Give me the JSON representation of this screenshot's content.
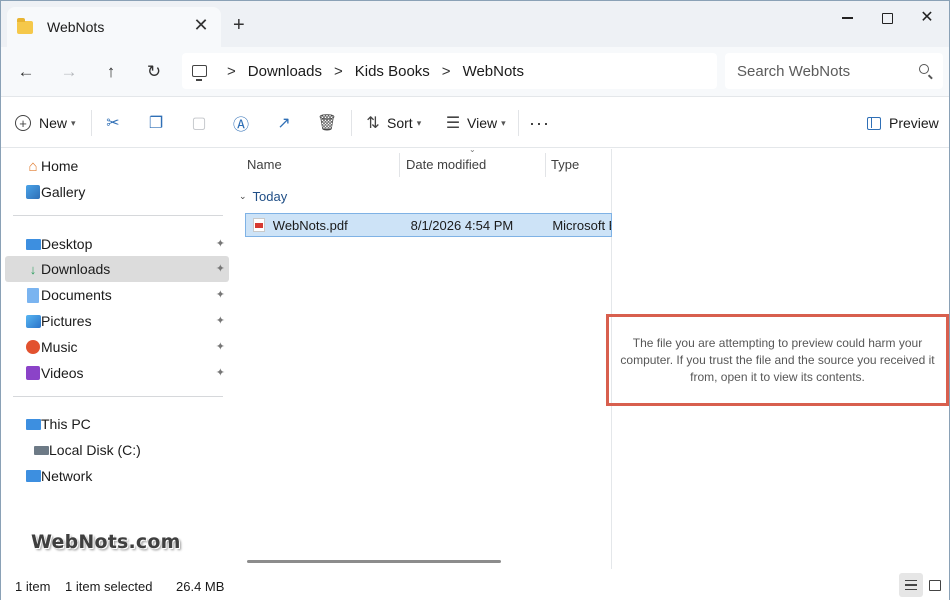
{
  "titlebar": {
    "tab_title": "WebNots",
    "tab_close": "✕",
    "new_tab": "+",
    "minimize": "",
    "maximize": "",
    "close": "✕"
  },
  "navbar": {
    "back": "←",
    "forward": "→",
    "up": "↑",
    "refresh": "↻",
    "breadcrumbs": [
      "Downloads",
      "Kids Books",
      "WebNots"
    ],
    "separator": ">",
    "search_placeholder": "Search WebNots"
  },
  "toolbar": {
    "new_label": "New",
    "sort_label": "Sort",
    "view_label": "View",
    "more": "···",
    "preview_label": "Preview"
  },
  "sidebar": {
    "items": [
      {
        "label": "Home",
        "icon": "home-icon"
      },
      {
        "label": "Gallery",
        "icon": "gallery-icon"
      },
      {
        "label": "Desktop",
        "icon": "desktop-icon",
        "pinned": true
      },
      {
        "label": "Downloads",
        "icon": "downloads-icon",
        "pinned": true,
        "selected": true
      },
      {
        "label": "Documents",
        "icon": "documents-icon",
        "pinned": true
      },
      {
        "label": "Pictures",
        "icon": "pictures-icon",
        "pinned": true
      },
      {
        "label": "Music",
        "icon": "music-icon",
        "pinned": true
      },
      {
        "label": "Videos",
        "icon": "videos-icon",
        "pinned": true
      },
      {
        "label": "This PC",
        "icon": "this-pc-icon"
      },
      {
        "label": "Local Disk (C:)",
        "icon": "local-disk-icon"
      },
      {
        "label": "Network",
        "icon": "network-icon"
      }
    ],
    "pin_glyph": "📌"
  },
  "brand": "WebNots.com",
  "filelist": {
    "columns": [
      "Name",
      "Date modified",
      "Type"
    ],
    "group_label": "Today",
    "rows": [
      {
        "name": "WebNots.pdf",
        "date": "8/1/2026 4:54 PM",
        "type": "Microsoft Ec"
      }
    ]
  },
  "preview": {
    "message": "The file you are attempting to preview could harm your computer. If you trust the file and the source you received it from, open it to view its contents."
  },
  "status": {
    "count": "1 item",
    "selection": "1 item selected",
    "size": "26.4 MB"
  },
  "colors": {
    "accent": "#2f6fb6",
    "selection_bg": "#cde3f7",
    "highlight_border": "#d85f4e"
  }
}
